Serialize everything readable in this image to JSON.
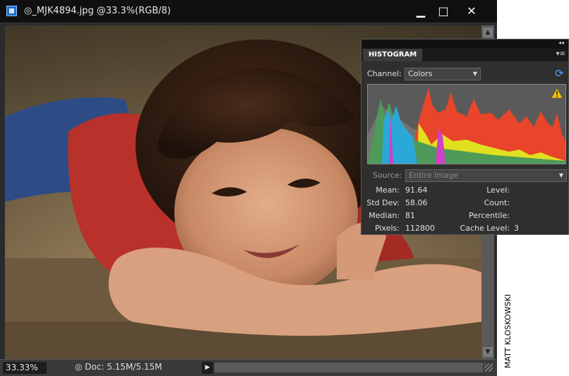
{
  "window": {
    "title": "◎_MJK4894.jpg @33.3%(RGB/8)",
    "minimize_icon": "minimize-icon",
    "maximize_icon": "maximize-icon",
    "close_icon": "close-icon",
    "min_glyph": "▁",
    "max_glyph": "□",
    "close_glyph": "✕"
  },
  "statusbar": {
    "zoom": "33.33%",
    "doc_info": "◎ Doc: 5.15M/5.15M",
    "arrow": "▶"
  },
  "histogram": {
    "tab": "HISTOGRAM",
    "channel_label": "Channel:",
    "channel_value": "Colors",
    "source_label": "Source:",
    "source_value": "Entire Image",
    "stats": {
      "mean_label": "Mean:",
      "mean": "91.64",
      "stddev_label": "Std Dev:",
      "stddev": "58.06",
      "median_label": "Median:",
      "median": "81",
      "pixels_label": "Pixels:",
      "pixels": "112800",
      "level_label": "Level:",
      "level": "",
      "count_label": "Count:",
      "count": "",
      "percentile_label": "Percentile:",
      "percentile": "",
      "cache_label": "Cache Level:",
      "cache": "3"
    }
  },
  "credit": "MATT KLOSKOWSKI",
  "colors": {
    "red": "#e8452a",
    "yellow": "#e0e020",
    "green": "#4e9a58",
    "cyan": "#2aa8d8",
    "magenta": "#d040c8",
    "gray": "#737373"
  }
}
